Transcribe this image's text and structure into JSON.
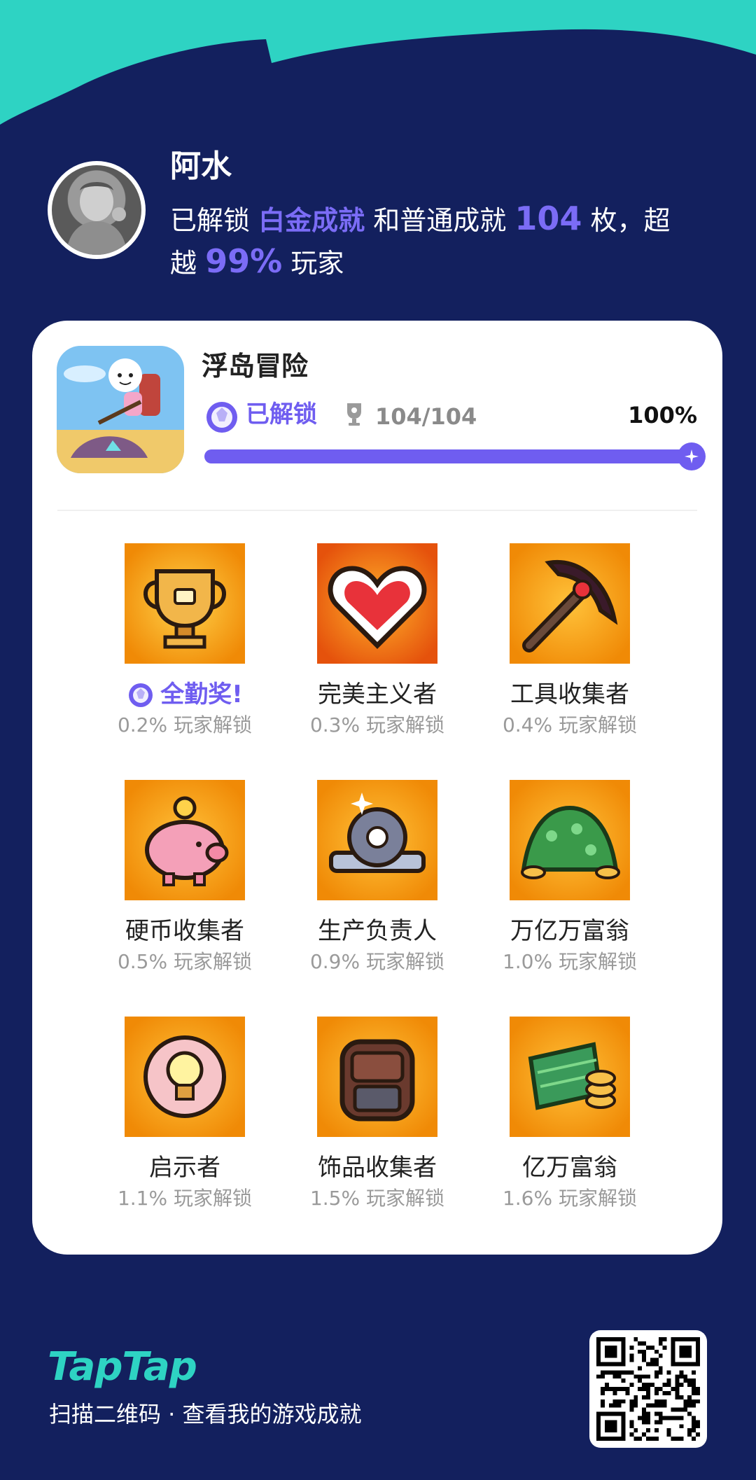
{
  "user": {
    "name": "阿水",
    "summary_prefix": "已解锁",
    "platinum_label": "白金成就",
    "summary_mid": "和普通成就",
    "count": "104",
    "summary_suffix1": "枚，超",
    "summary_suffix2": "越",
    "percentile": "99%",
    "summary_end": "玩家"
  },
  "game": {
    "title": "浮岛冒险",
    "unlocked_label": "已解锁",
    "progress_text": "104/104",
    "percent_text": "100%",
    "progress_fraction": 1.0
  },
  "achievements": [
    {
      "name": "全勤奖!",
      "rate": "0.2% 玩家解锁",
      "icon": "trophy-icon",
      "special": true
    },
    {
      "name": "完美主义者",
      "rate": "0.3% 玩家解锁",
      "icon": "heart-icon"
    },
    {
      "name": "工具收集者",
      "rate": "0.4% 玩家解锁",
      "icon": "pickaxe-icon"
    },
    {
      "name": "硬币收集者",
      "rate": "0.5% 玩家解锁",
      "icon": "piggy-bank-icon"
    },
    {
      "name": "生产负责人",
      "rate": "0.9% 玩家解锁",
      "icon": "gear-wrench-icon"
    },
    {
      "name": "万亿万富翁",
      "rate": "1.0% 玩家解锁",
      "icon": "money-pile-icon"
    },
    {
      "name": "启示者",
      "rate": "1.1% 玩家解锁",
      "icon": "lightbulb-icon"
    },
    {
      "name": "饰品收集者",
      "rate": "1.5% 玩家解锁",
      "icon": "backpack-icon"
    },
    {
      "name": "亿万富翁",
      "rate": "1.6% 玩家解锁",
      "icon": "cash-stack-icon"
    }
  ],
  "footer": {
    "logo": "TapTap",
    "scan_text": "扫描二维码 · 查看我的游戏成就"
  },
  "colors": {
    "background": "#13205e",
    "accent_teal": "#2ed3c3",
    "accent_purple": "#6f5df0",
    "tile_orange": "#f39b0b"
  }
}
